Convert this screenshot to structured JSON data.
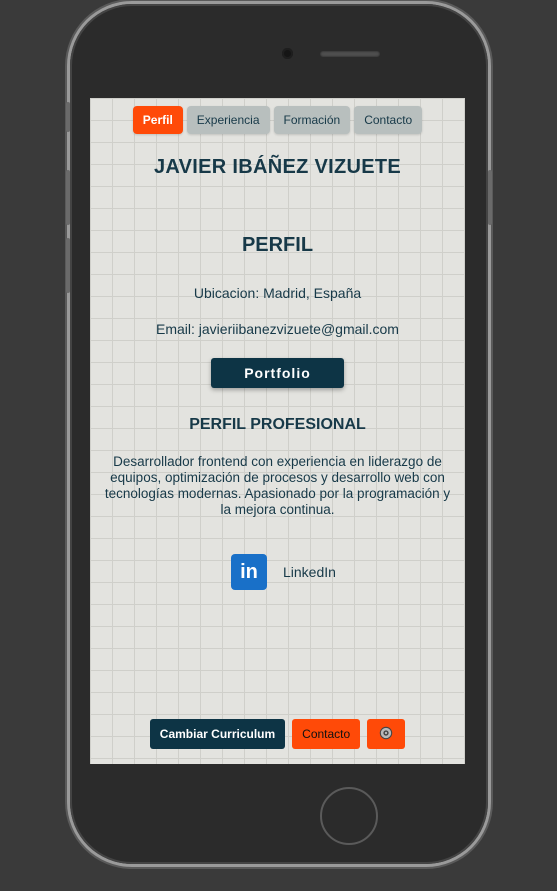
{
  "nav": {
    "items": [
      {
        "label": "Perfil",
        "active": true
      },
      {
        "label": "Experiencia",
        "active": false
      },
      {
        "label": "Formación",
        "active": false
      },
      {
        "label": "Contacto",
        "active": false
      }
    ]
  },
  "profile": {
    "name": "JAVIER IBÁÑEZ VIZUETE",
    "section_title": "PERFIL",
    "location": "Ubicacion: Madrid, España",
    "email": "Email: javieriibanezvizuete@gmail.com",
    "portfolio_label": "Portfolio",
    "pro_title": "PERFIL PROFESIONAL",
    "description": "Desarrollador frontend con experiencia en liderazgo de equipos, optimización de procesos y desarrollo web con tecnologías modernas. Apasionado por la programación y la mejora continua.",
    "linkedin_icon_text": "in",
    "linkedin_label": "LinkedIn"
  },
  "footer": {
    "change_cv_label": "Cambiar Curriculum",
    "contact_label": "Contacto",
    "settings_icon": "gear-icon"
  },
  "colors": {
    "accent": "#ff4a08",
    "dark": "#0d3445",
    "text": "#173948",
    "linkedin": "#1970c8"
  }
}
